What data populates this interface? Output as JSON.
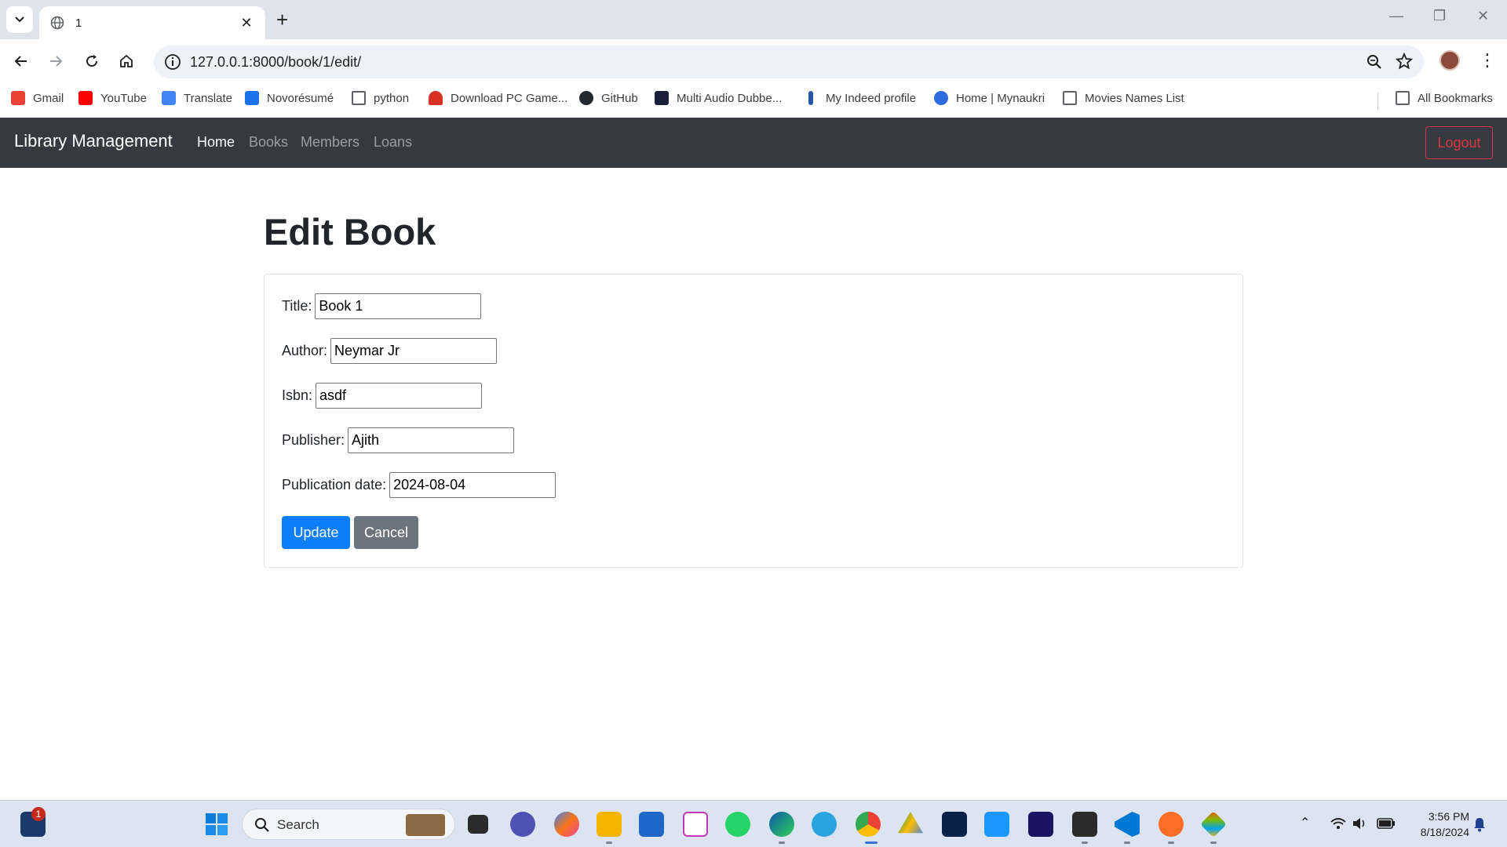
{
  "browser": {
    "tab_title": "1",
    "url": "127.0.0.1:8000/book/1/edit/",
    "bookmarks": [
      {
        "label": "Gmail",
        "icon": "gmail-icon",
        "color": "#ea4335"
      },
      {
        "label": "YouTube",
        "icon": "youtube-icon",
        "color": "#ff0000"
      },
      {
        "label": "Translate",
        "icon": "translate-icon",
        "color": "#4285f4"
      },
      {
        "label": "Novorésumé",
        "icon": "novoresume-icon",
        "color": "#1a73e8"
      },
      {
        "label": "python",
        "icon": "folder-icon",
        "color": "#5f6368"
      },
      {
        "label": "Download PC Game...",
        "icon": "ghost-icon",
        "color": "#d93025"
      },
      {
        "label": "GitHub",
        "icon": "github-icon",
        "color": "#24292f"
      },
      {
        "label": "Multi Audio Dubbe...",
        "icon": "movie-icon",
        "color": "#1b1f3a"
      },
      {
        "label": "My Indeed profile",
        "icon": "indeed-icon",
        "color": "#2557a7"
      },
      {
        "label": "Home | Mynaukri",
        "icon": "naukri-icon",
        "color": "#2d6cdf"
      },
      {
        "label": "Movies Names List",
        "icon": "folder-icon",
        "color": "#5f6368"
      }
    ],
    "all_bookmarks": "All Bookmarks"
  },
  "app": {
    "brand": "Library Management",
    "nav": [
      "Home",
      "Books",
      "Members",
      "Loans"
    ],
    "logout": "Logout"
  },
  "form": {
    "heading": "Edit Book",
    "fields": [
      {
        "label": "Title:",
        "value": "Book 1"
      },
      {
        "label": "Author:",
        "value": "Neymar Jr"
      },
      {
        "label": "Isbn:",
        "value": "asdf"
      },
      {
        "label": "Publisher:",
        "value": "Ajith"
      },
      {
        "label": "Publication date:",
        "value": "2024-08-04"
      }
    ],
    "update": "Update",
    "cancel": "Cancel"
  },
  "taskbar": {
    "search": "Search",
    "notification_count": "1",
    "time": "3:56 PM",
    "date": "8/18/2024"
  },
  "colors": {
    "primary": "#0d7efb",
    "secondary": "#6c757d",
    "navbar": "#343a40",
    "danger": "#dc3545"
  }
}
